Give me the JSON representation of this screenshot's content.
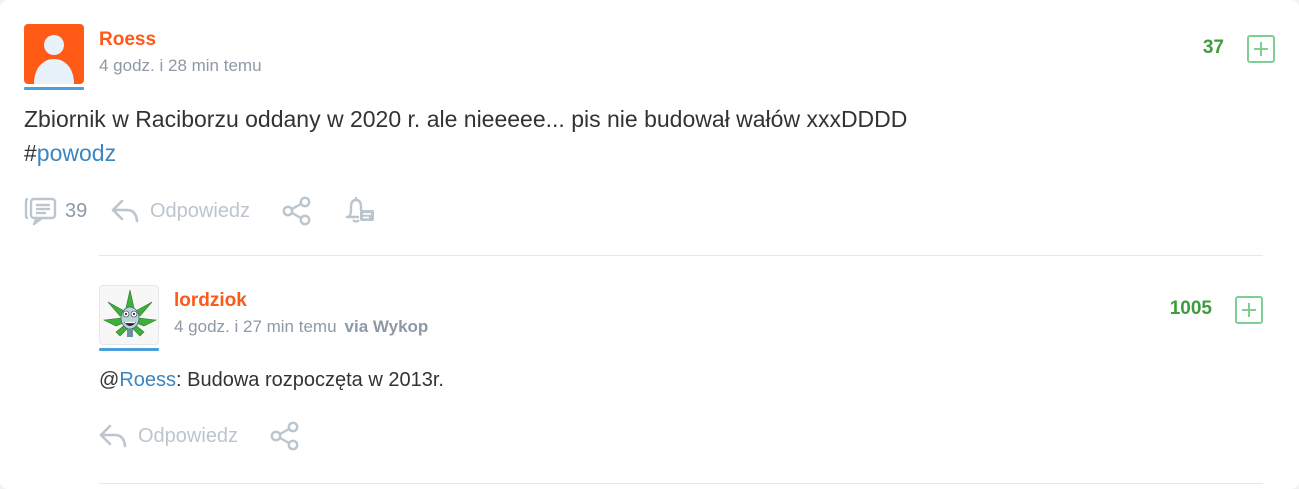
{
  "post": {
    "author": "Roess",
    "time": "4 godz. i 28 min temu",
    "votes": "37",
    "text": "Zbiornik w Raciborzu oddany w 2020 r. ale nieeeee... pis nie budował wałów xxxDDDD",
    "tag_prefix": "#",
    "tag": "powodz",
    "comment_count": "39",
    "reply_label": "Odpowiedz",
    "icons": [
      "comments-icon",
      "reply-icon",
      "share-icon",
      "notify-bell-icon",
      "plus-icon"
    ],
    "colors": {
      "username": "#ff5917",
      "votes": "#3b9d3b",
      "link": "#3c86c0",
      "meta": "#8d99a6"
    }
  },
  "comment": {
    "author": "lordziok",
    "time": "4 godz. i 27 min temu",
    "via": "via Wykop",
    "votes": "1005",
    "mention_prefix": "@",
    "mention": "Roess",
    "text": ": Budowa rozpoczęta w 2013r.",
    "reply_label": "Odpowiedz"
  }
}
